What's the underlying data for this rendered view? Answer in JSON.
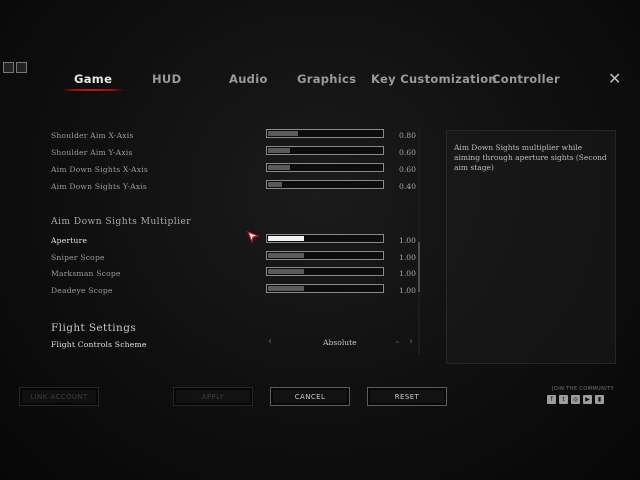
{
  "tabs": [
    {
      "label": "Game",
      "active": true
    },
    {
      "label": "HUD"
    },
    {
      "label": "Audio"
    },
    {
      "label": "Graphics"
    },
    {
      "label": "Key Customization"
    },
    {
      "label": "Controller"
    }
  ],
  "sensitivity": [
    {
      "label": "Shoulder Aim X-Axis",
      "value": "0.80",
      "level": 0.26
    },
    {
      "label": "Shoulder Aim Y-Axis",
      "value": "0.60",
      "level": 0.19
    },
    {
      "label": "Aim Down Sights X-Axis",
      "value": "0.60",
      "level": 0.19
    },
    {
      "label": "Aim Down Sights Y-Axis",
      "value": "0.40",
      "level": 0.12
    }
  ],
  "ads_multiplier": {
    "heading": "Aim Down Sights Multiplier",
    "rows": [
      {
        "label": "Aperture",
        "value": "1.00",
        "level": 0.32,
        "selected": true
      },
      {
        "label": "Sniper Scope",
        "value": "1.00",
        "level": 0.32
      },
      {
        "label": "Marksman Scope",
        "value": "1.00",
        "level": 0.32
      },
      {
        "label": "Deadeye Scope",
        "value": "1.00",
        "level": 0.32
      }
    ]
  },
  "flight": {
    "heading": "Flight Settings",
    "scheme_label": "Flight Controls Scheme",
    "scheme_value": "Absolute"
  },
  "description": "Aim Down Sights multiplier while aiming through aperture sights (Second aim stage)",
  "buttons": {
    "link_account": "LINK ACCOUNT",
    "apply": "APPLY",
    "cancel": "CANCEL",
    "reset": "RESET"
  },
  "community": "JOIN THE COMMUNITY",
  "social_icons": [
    "facebook-icon",
    "twitter-icon",
    "instagram-icon",
    "youtube-icon",
    "twitch-icon"
  ],
  "colors": {
    "accent": "#b01515",
    "slider_active": "#f2f2f2",
    "slider_inactive": "#5a5a5a"
  }
}
